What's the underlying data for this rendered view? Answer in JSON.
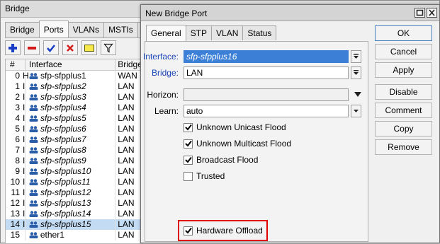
{
  "bridge_window": {
    "title": "Bridge",
    "tabs": [
      "Bridge",
      "Ports",
      "VLANs",
      "MSTIs",
      "Po"
    ],
    "active_tab": "Ports",
    "toolbar": [
      "add-icon",
      "remove-icon",
      "enable-icon",
      "disable-icon",
      "comment-icon",
      "filter-icon"
    ],
    "columns": [
      "#",
      "Interface",
      "Bridge"
    ],
    "rows": [
      {
        "num": "0",
        "flag": "H",
        "interface": "sfp-sfpplus1",
        "bridge": "WAN",
        "italic": false,
        "selected": false
      },
      {
        "num": "1",
        "flag": "I",
        "interface": "sfp-sfpplus2",
        "bridge": "LAN",
        "italic": true,
        "selected": false
      },
      {
        "num": "2",
        "flag": "I",
        "interface": "sfp-sfpplus3",
        "bridge": "LAN",
        "italic": true,
        "selected": false
      },
      {
        "num": "3",
        "flag": "I",
        "interface": "sfp-sfpplus4",
        "bridge": "LAN",
        "italic": true,
        "selected": false
      },
      {
        "num": "4",
        "flag": "I",
        "interface": "sfp-sfpplus5",
        "bridge": "LAN",
        "italic": true,
        "selected": false
      },
      {
        "num": "5",
        "flag": "I",
        "interface": "sfp-sfpplus6",
        "bridge": "LAN",
        "italic": true,
        "selected": false
      },
      {
        "num": "6",
        "flag": "I",
        "interface": "sfp-sfpplus7",
        "bridge": "LAN",
        "italic": true,
        "selected": false
      },
      {
        "num": "7",
        "flag": "I",
        "interface": "sfp-sfpplus8",
        "bridge": "LAN",
        "italic": true,
        "selected": false
      },
      {
        "num": "8",
        "flag": "I",
        "interface": "sfp-sfpplus9",
        "bridge": "LAN",
        "italic": true,
        "selected": false
      },
      {
        "num": "9",
        "flag": "I",
        "interface": "sfp-sfpplus10",
        "bridge": "LAN",
        "italic": true,
        "selected": false
      },
      {
        "num": "10",
        "flag": "I",
        "interface": "sfp-sfpplus11",
        "bridge": "LAN",
        "italic": true,
        "selected": false
      },
      {
        "num": "11",
        "flag": "I",
        "interface": "sfp-sfpplus12",
        "bridge": "LAN",
        "italic": true,
        "selected": false
      },
      {
        "num": "12",
        "flag": "I",
        "interface": "sfp-sfpplus13",
        "bridge": "LAN",
        "italic": true,
        "selected": false
      },
      {
        "num": "13",
        "flag": "I",
        "interface": "sfp-sfpplus14",
        "bridge": "LAN",
        "italic": true,
        "selected": false
      },
      {
        "num": "14",
        "flag": "I",
        "interface": "sfp-sfpplus15",
        "bridge": "LAN",
        "italic": true,
        "selected": true
      },
      {
        "num": "15",
        "flag": "",
        "interface": "ether1",
        "bridge": "LAN",
        "italic": false,
        "selected": false
      }
    ]
  },
  "dialog": {
    "title": "New Bridge Port",
    "tabs": [
      "General",
      "STP",
      "VLAN",
      "Status"
    ],
    "active_tab": "General",
    "fields": {
      "interface_label": "Interface:",
      "interface_value": "sfp-sfpplus16",
      "bridge_label": "Bridge:",
      "bridge_value": "LAN",
      "horizon_label": "Horizon:",
      "horizon_value": "",
      "learn_label": "Learn:",
      "learn_value": "auto"
    },
    "checkboxes": [
      {
        "label": "Unknown Unicast Flood",
        "checked": true
      },
      {
        "label": "Unknown Multicast Flood",
        "checked": true
      },
      {
        "label": "Broadcast Flood",
        "checked": true
      },
      {
        "label": "Trusted",
        "checked": false
      },
      {
        "label": "Hardware Offload",
        "checked": true
      }
    ],
    "buttons": [
      "OK",
      "Cancel",
      "Apply",
      "Disable",
      "Comment",
      "Copy",
      "Remove"
    ],
    "highlight_color": "#e00000",
    "selection_color": "#3b7fd7"
  }
}
